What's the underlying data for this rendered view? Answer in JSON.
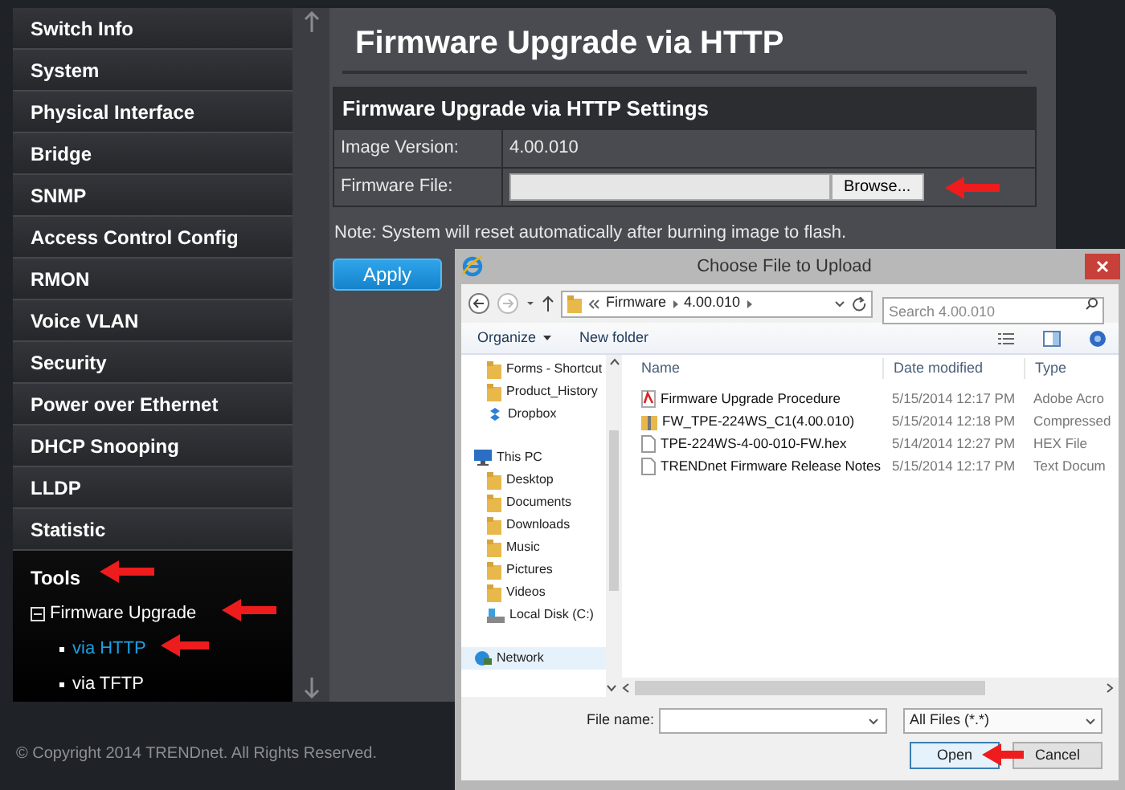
{
  "sidebar": {
    "items": [
      {
        "label": "Switch Info",
        "expanded": false
      },
      {
        "label": "System",
        "expanded": false
      },
      {
        "label": "Physical Interface",
        "expanded": false
      },
      {
        "label": "Bridge",
        "expanded": false
      },
      {
        "label": "SNMP",
        "expanded": false
      },
      {
        "label": "Access Control Config",
        "expanded": false
      },
      {
        "label": "RMON",
        "expanded": false
      },
      {
        "label": "Voice VLAN",
        "expanded": false
      },
      {
        "label": "Security",
        "expanded": false
      },
      {
        "label": "Power over Ethernet",
        "expanded": false
      },
      {
        "label": "DHCP Snooping",
        "expanded": false
      },
      {
        "label": "LLDP",
        "expanded": false
      },
      {
        "label": "Statistic",
        "expanded": false
      },
      {
        "label": "Tools",
        "expanded": true,
        "children": [
          {
            "label": "Firmware Upgrade",
            "expanded": true,
            "children": [
              {
                "label": "via HTTP",
                "selected": true
              },
              {
                "label": "via TFTP",
                "selected": false
              }
            ]
          }
        ]
      }
    ]
  },
  "page": {
    "title": "Firmware Upgrade via HTTP",
    "settings": {
      "heading": "Firmware Upgrade via HTTP Settings",
      "rows": [
        {
          "kind": "text",
          "label": "Image Version:",
          "value": "4.00.010"
        },
        {
          "kind": "file",
          "label": "Firmware File:",
          "button": "Browse..."
        }
      ]
    },
    "note": "Note: System will reset automatically after burning image to flash.",
    "apply_button": "Apply"
  },
  "footer": "© Copyright 2014 TRENDnet. All Rights Reserved.",
  "dialog": {
    "title": "Choose File to Upload",
    "breadcrumb": [
      "Firmware",
      "4.00.010"
    ],
    "search": {
      "placeholder": "Search 4.00.010"
    },
    "commands": [
      "Organize",
      "New folder"
    ],
    "nav": [
      {
        "children": [
          {
            "label": "Forms - Shortcut",
            "kind": "folder",
            "selected": false
          },
          {
            "label": "Product_History",
            "kind": "folder",
            "selected": false
          },
          {
            "label": "Dropbox",
            "kind": "cloud",
            "selected": false
          }
        ]
      },
      {
        "label": "This PC",
        "kind": "computer",
        "selected": false,
        "children": [
          {
            "label": "Desktop",
            "kind": "folder",
            "selected": false
          },
          {
            "label": "Documents",
            "kind": "folder",
            "selected": false
          },
          {
            "label": "Downloads",
            "kind": "folder",
            "selected": false
          },
          {
            "label": "Music",
            "kind": "folder",
            "selected": false
          },
          {
            "label": "Pictures",
            "kind": "folder",
            "selected": false
          },
          {
            "label": "Videos",
            "kind": "folder",
            "selected": false
          },
          {
            "label": "Local Disk (C:)",
            "kind": "drive",
            "selected": false
          }
        ]
      },
      {
        "label": "Network",
        "kind": "network",
        "selected": true
      }
    ],
    "columns": [
      "Name",
      "Date modified",
      "Type"
    ],
    "files": [
      {
        "kind": "pdf",
        "name": "Firmware Upgrade Procedure",
        "date": "5/15/2014 12:17 PM",
        "type": "Adobe Acro"
      },
      {
        "kind": "zip",
        "name": "FW_TPE-224WS_C1(4.00.010)",
        "date": "5/15/2014 12:18 PM",
        "type": "Compressed"
      },
      {
        "kind": "file",
        "name": "TPE-224WS-4-00-010-FW.hex",
        "date": "5/14/2014 12:27 PM",
        "type": "HEX File"
      },
      {
        "kind": "file",
        "name": "TRENDnet Firmware Release Notes",
        "date": "5/15/2014 12:17 PM",
        "type": "Text Docum"
      }
    ],
    "file_name_label": "File name:",
    "filter": "All Files (*.*)",
    "buttons": [
      "Open",
      "Cancel"
    ]
  }
}
